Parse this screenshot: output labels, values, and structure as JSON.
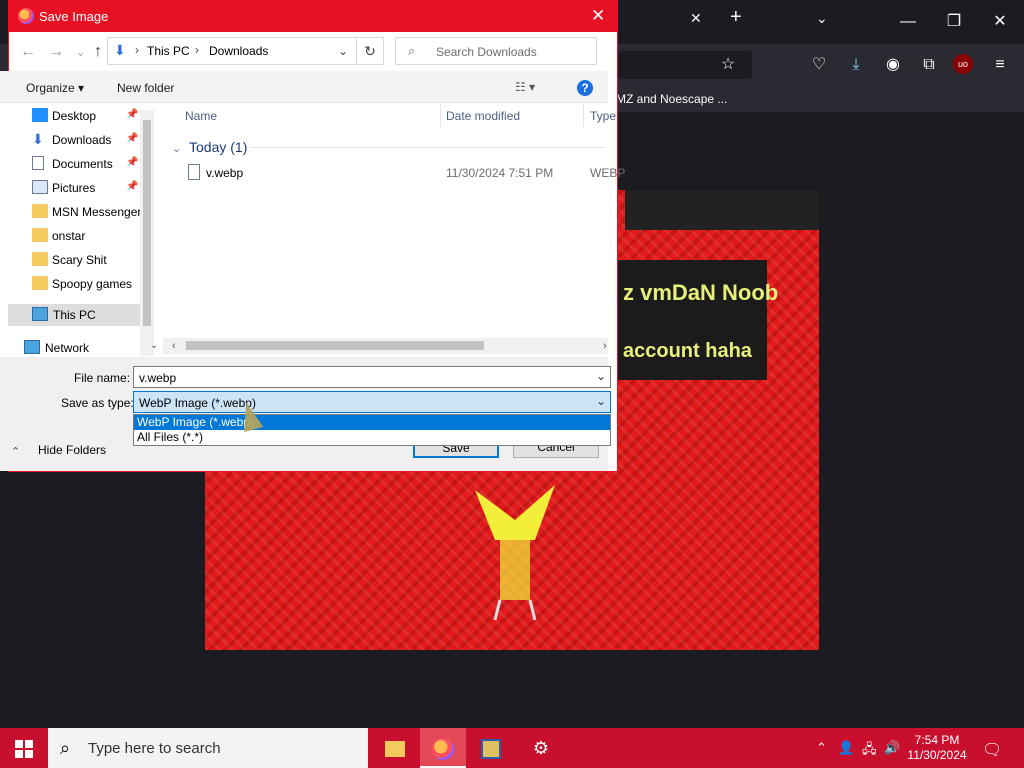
{
  "browser": {
    "tab_close": "✕",
    "tab_new": "+",
    "tab_list": "⌄",
    "win_min": "—",
    "win_restore": "❐",
    "win_close": "✕",
    "bookmark_text": "MZ and Noescape ...",
    "icons": [
      "star-icon",
      "pocket-icon",
      "download-icon",
      "account-icon",
      "extensions-icon",
      "ublock-icon",
      "menu-icon"
    ]
  },
  "webimage": {
    "text1": "z vmDaN Noob",
    "text2": "account haha"
  },
  "dialog": {
    "title": "Save Image",
    "close": "✕",
    "address": {
      "this_pc": "This PC",
      "downloads": "Downloads",
      "sep": "›"
    },
    "refresh": "↻",
    "search_placeholder": "Search Downloads",
    "toolbar": {
      "organize": "Organize ▾",
      "new_folder": "New folder",
      "help": "?"
    },
    "sidebar": [
      {
        "label": "Desktop",
        "pinned": true
      },
      {
        "label": "Downloads",
        "pinned": true
      },
      {
        "label": "Documents",
        "pinned": true
      },
      {
        "label": "Pictures",
        "pinned": true
      },
      {
        "label": "MSN Messenger",
        "pinned": false
      },
      {
        "label": "onstar",
        "pinned": false
      },
      {
        "label": "Scary Shit",
        "pinned": false
      },
      {
        "label": "Spoopy games",
        "pinned": false
      },
      {
        "label": "This PC",
        "pinned": false
      },
      {
        "label": "Network",
        "pinned": false
      }
    ],
    "columns": {
      "name": "Name",
      "date": "Date modified",
      "type": "Type"
    },
    "group": "Today (1)",
    "files": [
      {
        "name": "v.webp",
        "date": "11/30/2024 7:51 PM",
        "type": "WEBP"
      }
    ],
    "file_name_label": "File name:",
    "file_name_value": "v.webp",
    "save_type_label": "Save as type:",
    "save_type_value": "WebP Image (*.webp)",
    "save_type_options": [
      "WebP Image (*.webp)",
      "All Files (*.*)"
    ],
    "save_button": "Save",
    "cancel_button": "Cancel",
    "hide_folders": "Hide Folders"
  },
  "taskbar": {
    "search_placeholder": "Type here to search",
    "time": "7:54 PM",
    "date": "11/30/2024"
  },
  "colors": {
    "accent": "#e81123",
    "taskbar": "#c8102e",
    "selection": "#0078d7"
  }
}
